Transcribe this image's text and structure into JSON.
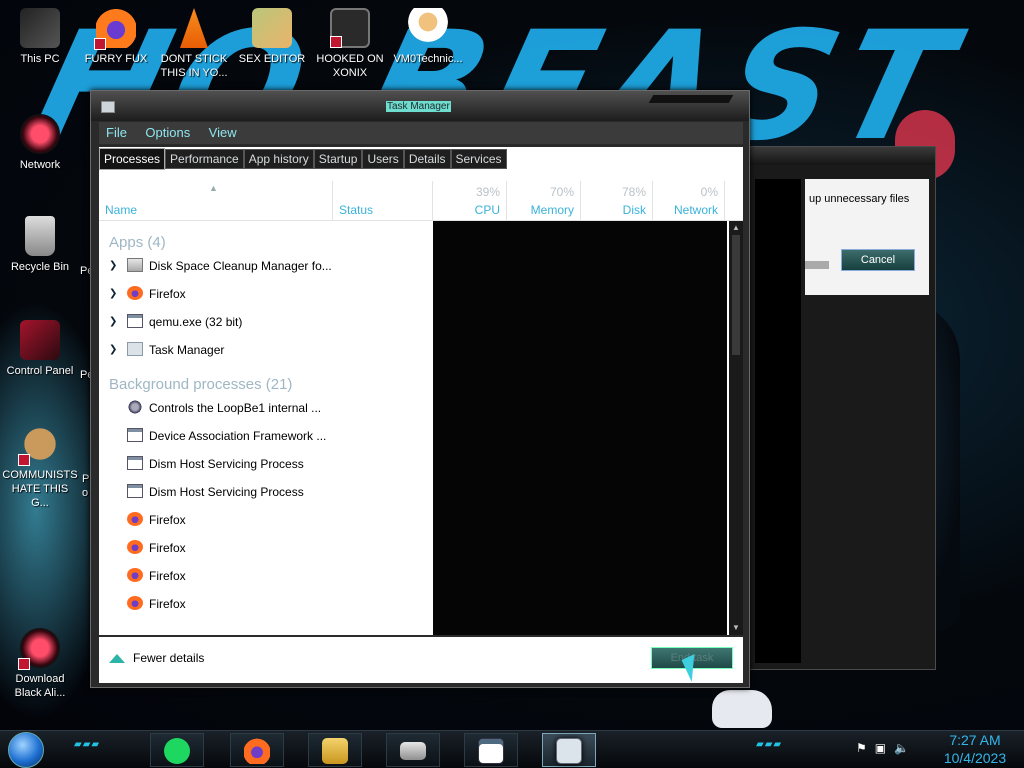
{
  "desktop": {
    "wallpaper_text": "HO BEAST",
    "icons": [
      {
        "name": "this-pc-icon",
        "label": "This PC"
      },
      {
        "name": "furry-fux-icon",
        "label": "FURRY FUX"
      },
      {
        "name": "dont-stick-icon",
        "label": "DONT STICK THIS IN YO..."
      },
      {
        "name": "sex-editor-icon",
        "label": "SEX EDITOR"
      },
      {
        "name": "hooked-on-xonix-icon",
        "label": "HOOKED ON XONIX"
      },
      {
        "name": "vm0technic-icon",
        "label": "VM0Technic..."
      },
      {
        "name": "network-icon",
        "label": "Network"
      },
      {
        "name": "recycle-bin-icon",
        "label": "Recycle Bin"
      },
      {
        "name": "control-panel-icon",
        "label": "Control Panel"
      },
      {
        "name": "communists-icon",
        "label": "COMMUNISTS HATE THIS G..."
      },
      {
        "name": "download-icon",
        "label": "Download Black Ali..."
      }
    ],
    "partial_labels": {
      "pe1": "Pe",
      "pe2": "Pe",
      "p": "P",
      "o": "o"
    }
  },
  "bg_window": {
    "text": "up unnecessary files",
    "cancel_label": "Cancel"
  },
  "task_manager": {
    "title": "Task Manager",
    "menu": {
      "file": "File",
      "options": "Options",
      "view": "View"
    },
    "tabs": [
      "Processes",
      "Performance",
      "App history",
      "Startup",
      "Users",
      "Details",
      "Services"
    ],
    "columns": {
      "name": "Name",
      "status": "Status",
      "cpu": {
        "pct": "39%",
        "label": "CPU"
      },
      "memory": {
        "pct": "70%",
        "label": "Memory"
      },
      "disk": {
        "pct": "78%",
        "label": "Disk"
      },
      "network": {
        "pct": "0%",
        "label": "Network"
      }
    },
    "apps_group": "Apps (4)",
    "apps": [
      {
        "name": "Disk Space Cleanup Manager fo...",
        "icon": "cleanup"
      },
      {
        "name": "Firefox",
        "icon": "firefox"
      },
      {
        "name": "qemu.exe (32 bit)",
        "icon": "win"
      },
      {
        "name": "Task Manager",
        "icon": "taskmgr"
      }
    ],
    "bg_group": "Background processes (21)",
    "background": [
      {
        "name": "Controls the LoopBe1 internal ...",
        "icon": "loop"
      },
      {
        "name": "Device Association Framework ...",
        "icon": "win"
      },
      {
        "name": "Dism Host Servicing Process",
        "icon": "win"
      },
      {
        "name": "Dism Host Servicing Process",
        "icon": "win"
      },
      {
        "name": "Firefox",
        "icon": "firefox"
      },
      {
        "name": "Firefox",
        "icon": "firefox"
      },
      {
        "name": "Firefox",
        "icon": "firefox"
      },
      {
        "name": "Firefox",
        "icon": "firefox"
      }
    ],
    "fewer_details": "Fewer details",
    "end_task": "End task"
  },
  "taskbar": {
    "clock_time": "7:27 AM",
    "clock_date": "10/4/2023",
    "pinned": [
      "notes",
      "firefox",
      "file-explorer",
      "disk-cleanup",
      "qemu",
      "task-manager"
    ]
  }
}
